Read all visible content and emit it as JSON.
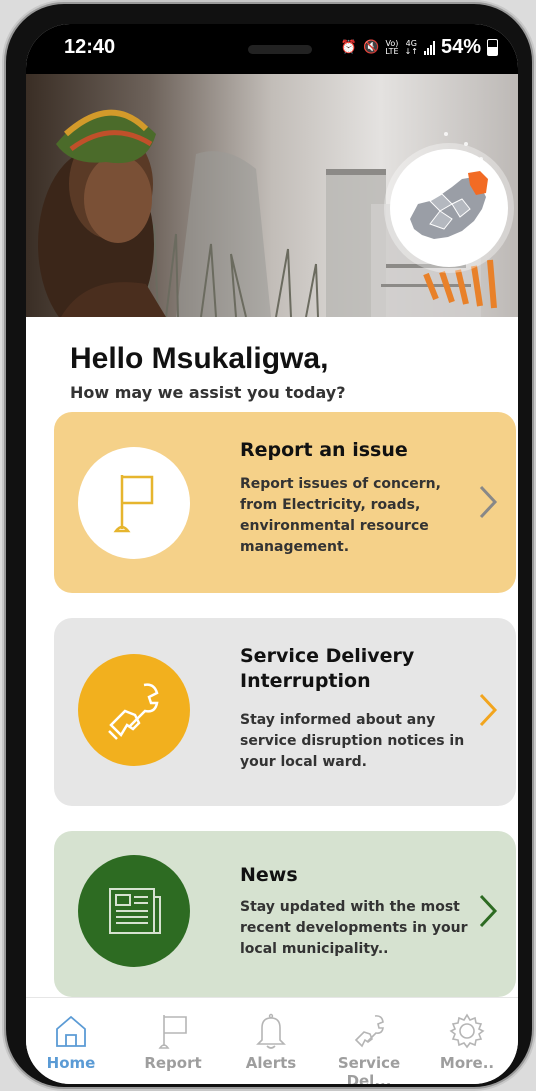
{
  "status_bar": {
    "time": "12:40",
    "network_top": "Vo)",
    "network_bottom": "LTE",
    "net_type_top": "4G",
    "net_type_bottom": "↓↑",
    "battery": "54%"
  },
  "greeting": {
    "title": "Hello  Msukaligwa,",
    "subtitle": "How may we assist you today?"
  },
  "cards": [
    {
      "title": "Report an issue",
      "description": "Report issues of concern, from Electricity, roads, environmental resource management.",
      "icon": "flag-icon",
      "background": "#f5d189",
      "circle_color": "#ffffff",
      "icon_color": "#e6b52e",
      "chevron_color": "#888888"
    },
    {
      "title": "Service Delivery Interruption",
      "description": "Stay informed about any service disruption notices in your local ward.",
      "icon": "wrench-hand-icon",
      "background": "#e6e6e6",
      "circle_color": "#f2b01e",
      "icon_color": "#ffffff",
      "chevron_color": "#f2a51e"
    },
    {
      "title": "News",
      "description": "Stay updated with the most recent developments in your local municipality..",
      "icon": "newspaper-icon",
      "background": "#d6e2d0",
      "circle_color": "#2d6b22",
      "icon_color": "#d6e2d0",
      "chevron_color": "#2d6b22"
    }
  ],
  "tab_bar": {
    "items": [
      {
        "label": "Home",
        "icon": "home-icon",
        "active": true
      },
      {
        "label": "Report",
        "icon": "flag-icon",
        "active": false
      },
      {
        "label": "Alerts",
        "icon": "bell-icon",
        "active": false
      },
      {
        "label": "Service Del...",
        "icon": "wrench-hand-icon",
        "active": false
      },
      {
        "label": "More..",
        "icon": "gear-icon",
        "active": false
      }
    ],
    "active_color": "#5b9bd5",
    "inactive_color": "#9e9e9e"
  }
}
